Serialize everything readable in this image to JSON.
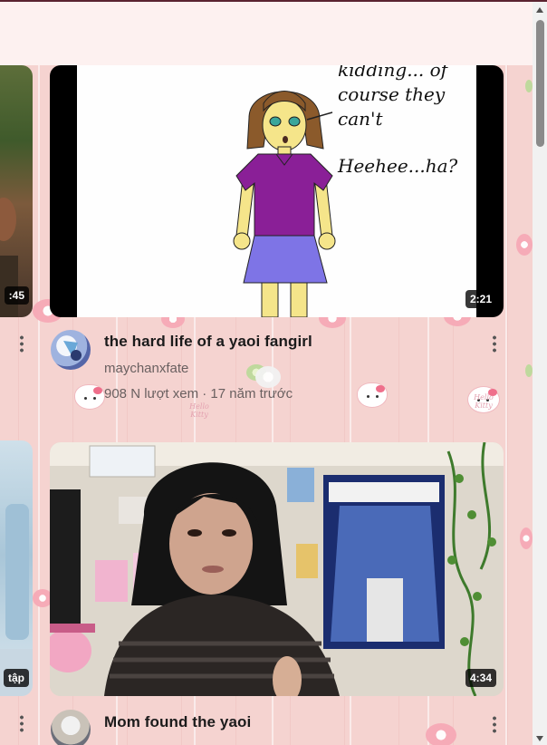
{
  "videos": [
    {
      "title": "the hard life of a yaoi fangirl",
      "channel": "maychanxfate",
      "meta": "908 N lượt xem · 17 năm trước",
      "duration": "2:21",
      "thumbnail_text": [
        "kidding... of",
        "course they",
        "can't",
        "Heehee...ha?"
      ]
    },
    {
      "title": "Mom found the yaoi",
      "duration": "4:34"
    }
  ],
  "left_column": {
    "duration_1": ":45",
    "duration_2": "tập"
  },
  "wallpaper": {
    "kitty_text": "Hello Kitty"
  },
  "colors": {
    "wallpaper": "#f5d3d0",
    "header": "#fdf1f0",
    "top_strip": "#5a2330",
    "shirt": "#8a1f97",
    "skirt": "#7e74e6"
  },
  "icons": {
    "more": "vertical-dots",
    "scroll_up": "triangle-up",
    "scroll_down": "triangle-down"
  }
}
